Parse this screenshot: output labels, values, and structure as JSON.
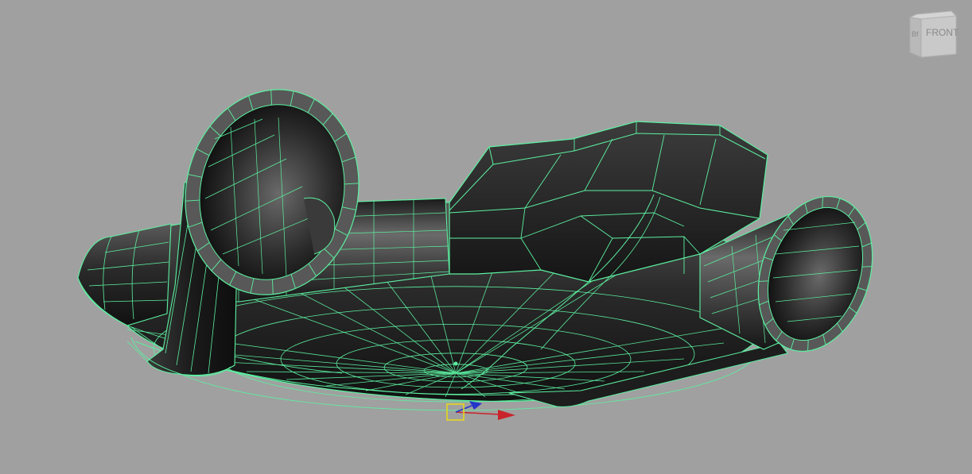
{
  "viewport": {
    "background": "#a0a0a0",
    "wire_color": "#5cf0a0",
    "shade_dark": "#1b1b1b",
    "shade_mid": "#3c3c3c",
    "shade_light": "#5e5e5e"
  },
  "viewcube": {
    "face_label": "FRONT",
    "side_label": "Bf",
    "icon": "view-cube-icon"
  },
  "manipulator": {
    "pivot_icon": "pivot-square-icon",
    "x_axis_icon": "x-axis-arrow-icon",
    "z_axis_icon": "z-axis-arrow-icon",
    "x_color": "#c8242a",
    "z_color": "#2436c8",
    "pivot_color": "#e6d81f"
  }
}
